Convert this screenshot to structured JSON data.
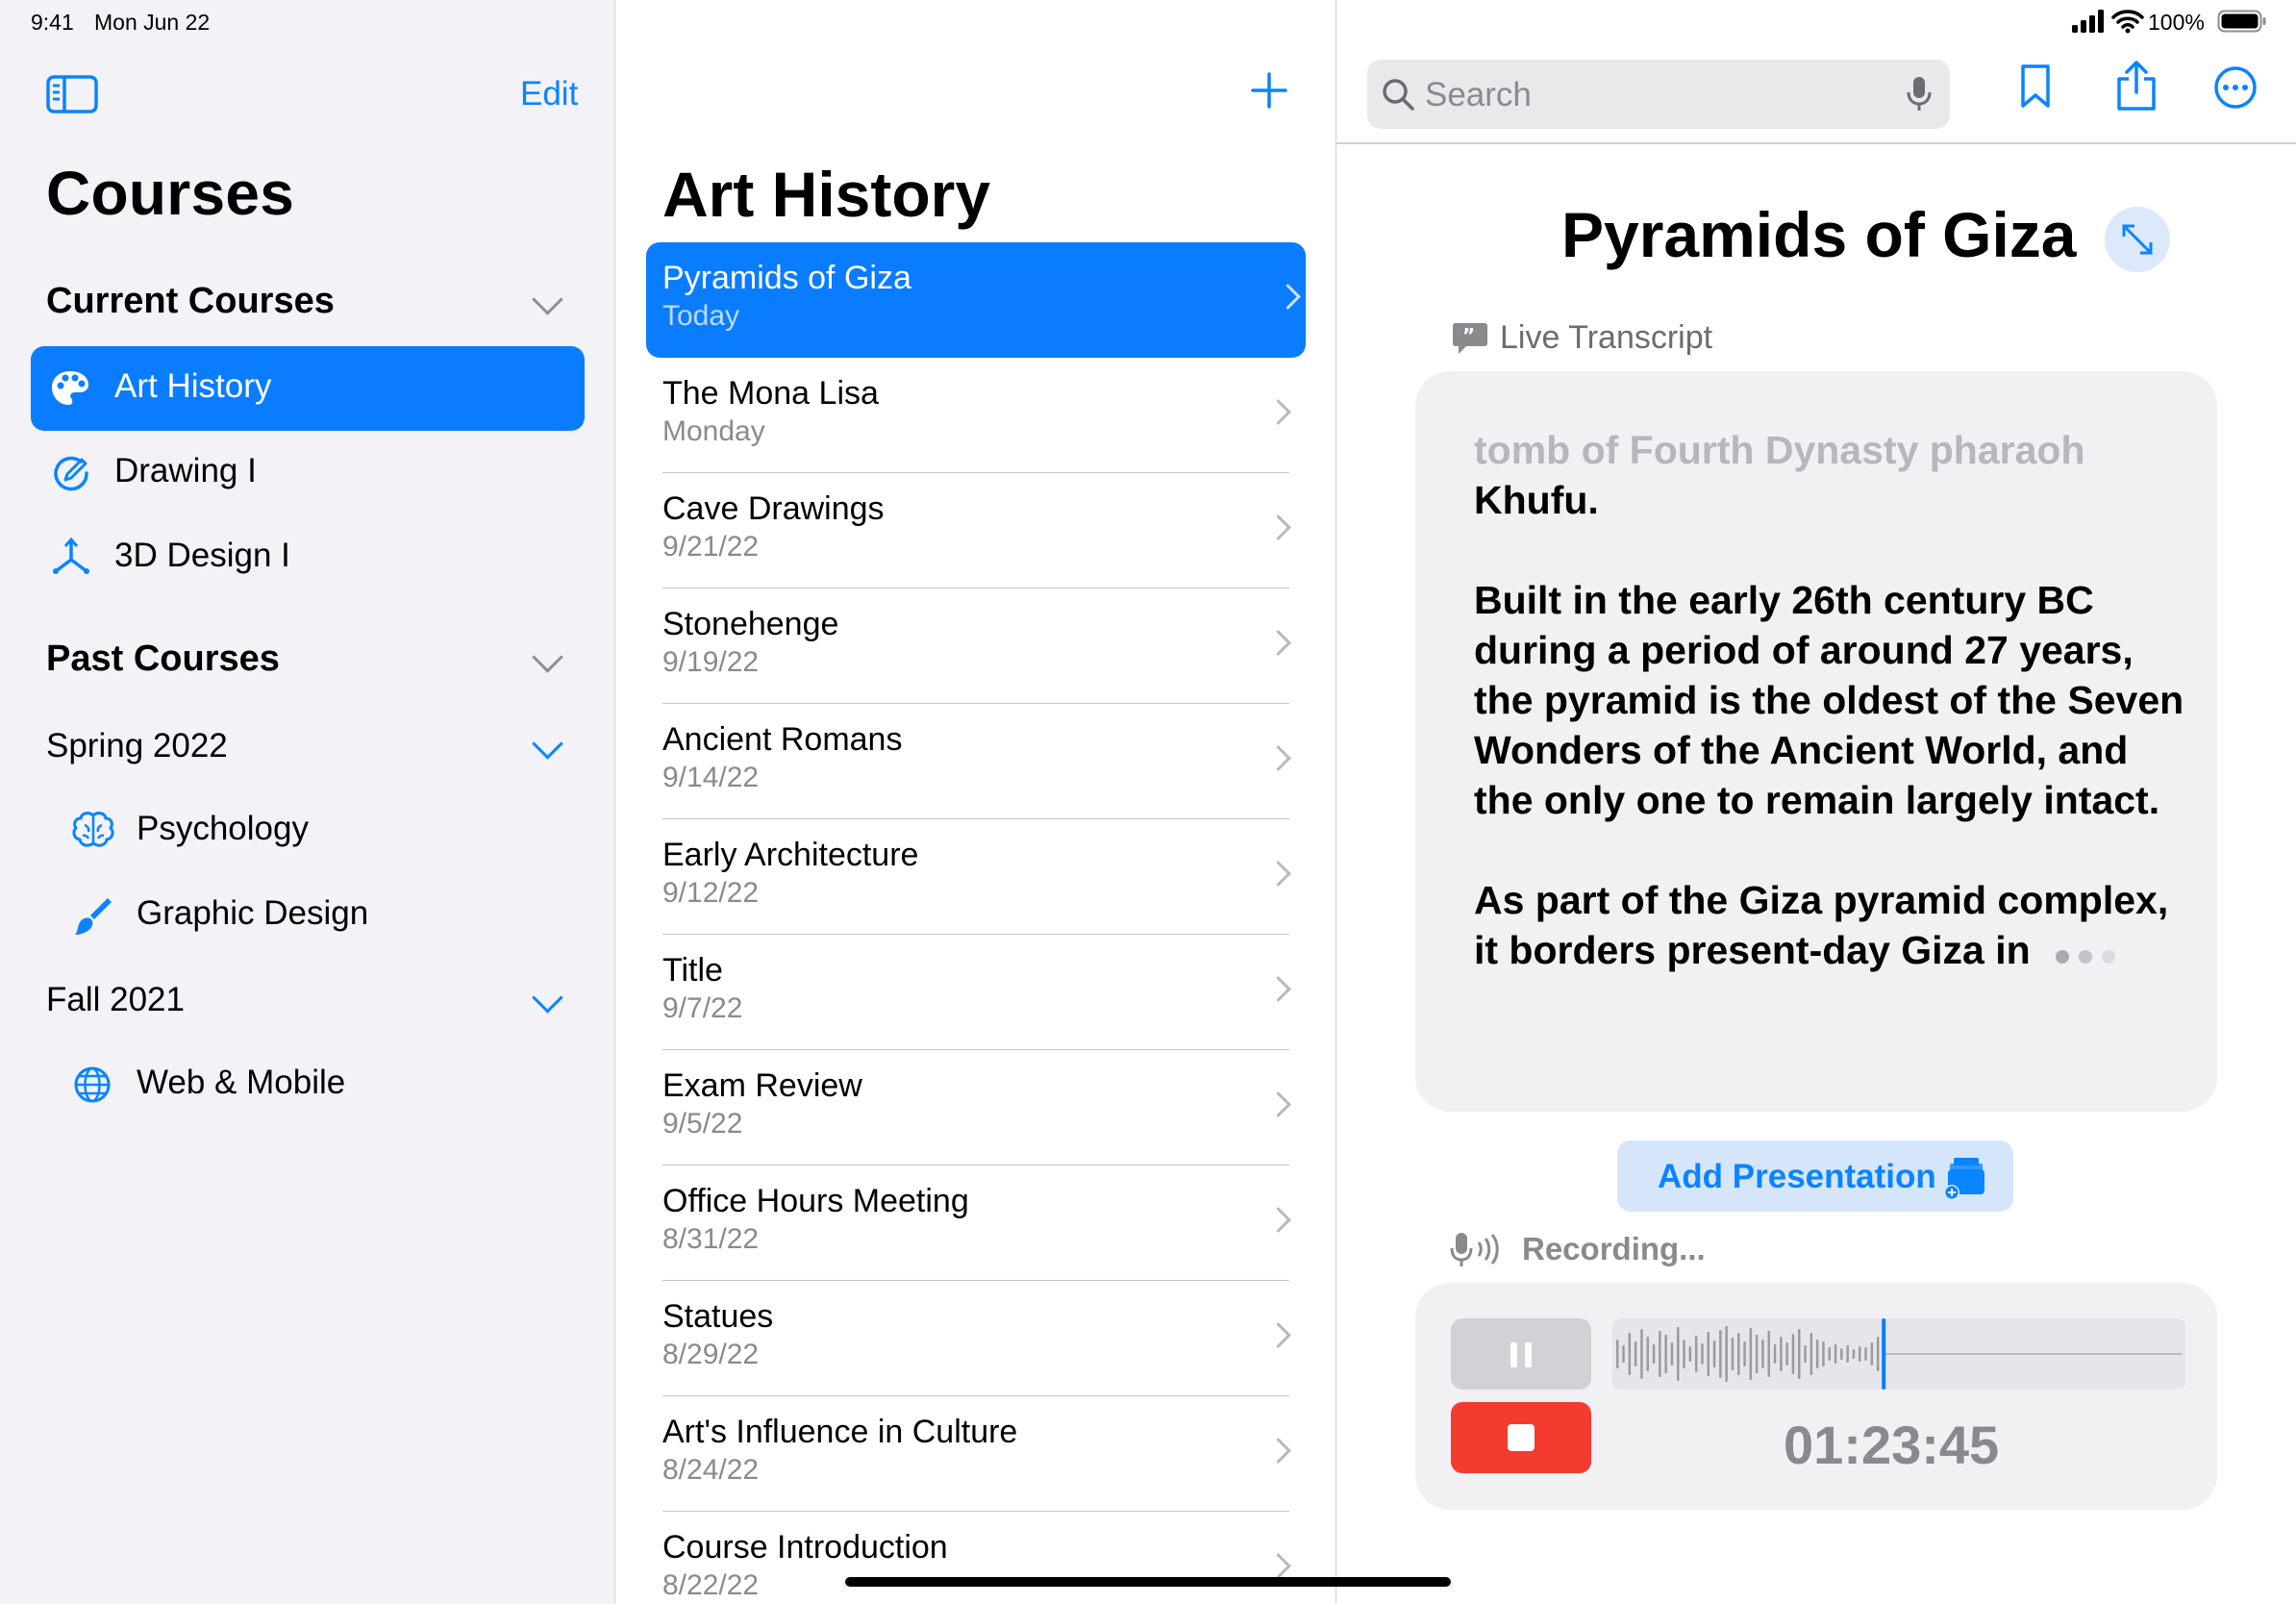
{
  "status_bar": {
    "time": "9:41",
    "date": "Mon Jun 22",
    "battery": "100%"
  },
  "sidebar": {
    "edit_label": "Edit",
    "title": "Courses",
    "current_section": "Current Courses",
    "current_items": [
      {
        "label": "Art History",
        "icon": "palette-icon",
        "selected": true
      },
      {
        "label": "Drawing I",
        "icon": "pencil-circle-icon"
      },
      {
        "label": "3D Design I",
        "icon": "axes-3d-icon"
      }
    ],
    "past_section": "Past Courses",
    "groups": [
      {
        "label": "Spring 2022",
        "items": [
          {
            "label": "Psychology",
            "icon": "brain-icon"
          },
          {
            "label": "Graphic Design",
            "icon": "paintbrush-icon"
          }
        ]
      },
      {
        "label": "Fall 2021",
        "items": [
          {
            "label": "Web & Mobile",
            "icon": "globe-icon"
          }
        ]
      }
    ]
  },
  "list": {
    "title": "Art History",
    "items": [
      {
        "title": "Pyramids of Giza",
        "date": "Today"
      },
      {
        "title": "The Mona Lisa",
        "date": "Monday"
      },
      {
        "title": "Cave Drawings",
        "date": "9/21/22"
      },
      {
        "title": "Stonehenge",
        "date": "9/19/22"
      },
      {
        "title": "Ancient Romans",
        "date": "9/14/22"
      },
      {
        "title": "Early Architecture",
        "date": "9/12/22"
      },
      {
        "title": "Title",
        "date": "9/7/22"
      },
      {
        "title": "Exam Review",
        "date": "9/5/22"
      },
      {
        "title": "Office Hours Meeting",
        "date": "8/31/22"
      },
      {
        "title": "Statues",
        "date": "8/29/22"
      },
      {
        "title": "Art's Influence in Culture",
        "date": "8/24/22"
      },
      {
        "title": "Course Introduction",
        "date": "8/22/22"
      }
    ]
  },
  "detail": {
    "search_placeholder": "Search",
    "title": "Pyramids of Giza",
    "live_transcript_label": "Live Transcript",
    "transcript_faded": "tomb of Fourth Dynasty pharaoh",
    "transcript_line1_end": "Khufu.",
    "transcript_para2": "Built in the early 26th century BC during a period of around 27 years, the pyramid is the oldest of the Seven Wonders of the Ancient World, and the only one to remain largely intact.",
    "transcript_para3": "As part of the Giza pyramid complex, it borders present-day Giza in",
    "add_presentation_label": "Add Presentation",
    "recording_label": "Recording...",
    "timer": "01:23:45"
  },
  "colors": {
    "accent": "#0a7cff",
    "stop_red": "#f43b30",
    "sidebar_bg": "#f2f2f7"
  }
}
